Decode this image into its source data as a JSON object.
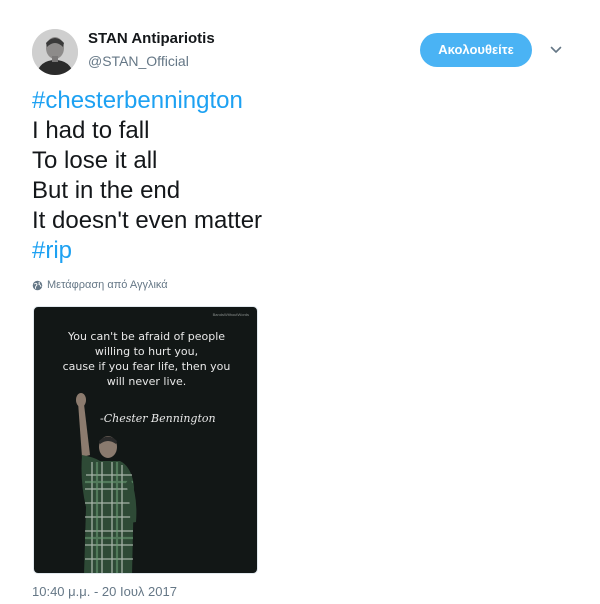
{
  "user": {
    "display_name": "STAN Antipariotis",
    "handle": "@STAN_Official",
    "avatar_icon": "profile-photo"
  },
  "actions": {
    "follow_label": "Ακολουθείτε",
    "menu_icon": "chevron-down-icon"
  },
  "tweet": {
    "lines": [
      {
        "text": "#chesterbennington",
        "hashtag": true
      },
      {
        "text": "I had to fall",
        "hashtag": false
      },
      {
        "text": "To lose it all",
        "hashtag": false
      },
      {
        "text": "But in the end",
        "hashtag": false
      },
      {
        "text": "It doesn't even matter",
        "hashtag": false
      },
      {
        "text": "#rip",
        "hashtag": true
      }
    ],
    "translate_label": "Μετάφραση από Αγγλικά",
    "translate_icon": "globe-icon"
  },
  "media": {
    "watermark": "BandsWithoutWords",
    "quote_lines": [
      "You can't be afraid of people",
      "willing to hurt you,",
      "cause if you fear life, then you",
      "will never live."
    ],
    "signature": "-Chester Bennington"
  },
  "timestamp": "10:40 μ.μ. - 20 Ιουλ 2017",
  "colors": {
    "accent": "#1da1f2",
    "follow_bg": "#4ab3f4",
    "secondary_text": "#657786",
    "primary_text": "#14171a"
  }
}
